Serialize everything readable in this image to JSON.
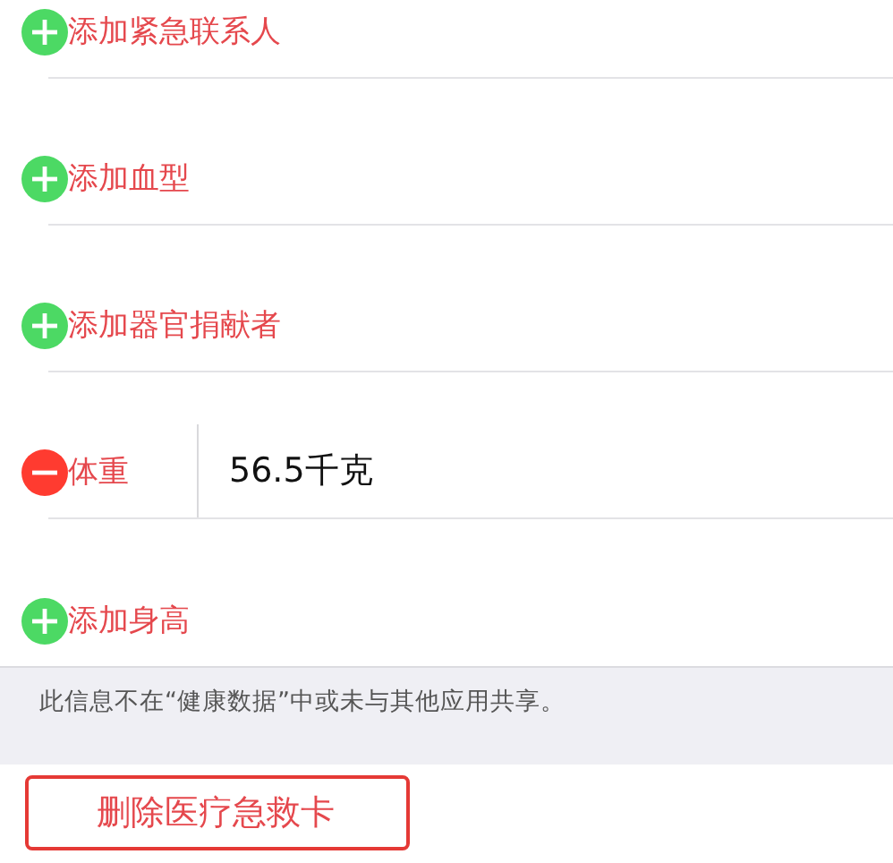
{
  "fields": [
    {
      "kind": "add",
      "label": "添加紧急联系人"
    },
    {
      "kind": "add",
      "label": "添加血型"
    },
    {
      "kind": "add",
      "label": "添加器官捐献者"
    },
    {
      "kind": "remove",
      "label": "体重",
      "value": "56.5千克"
    },
    {
      "kind": "add",
      "label": "添加身高"
    }
  ],
  "note": "此信息不在“健康数据”中或未与其他应用共享。",
  "delete_button": "删除医疗急救卡"
}
